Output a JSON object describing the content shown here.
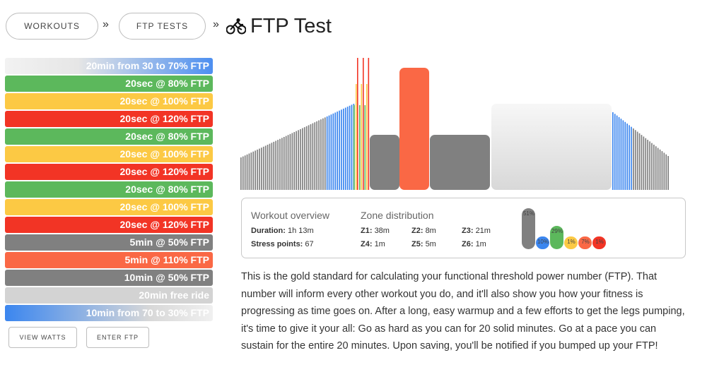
{
  "breadcrumb": {
    "workouts_label": "WORKOUTS",
    "ftp_tests_label": "FTP TESTS",
    "separator": "»",
    "title": "FTP Test",
    "title_icon": "cyclist-icon"
  },
  "segments": [
    {
      "label": "20min from 30 to 70% FTP",
      "color": "#4d8ff0"
    },
    {
      "label": "20sec @ 80% FTP",
      "color": "#5cb85c"
    },
    {
      "label": "20sec @ 100% FTP",
      "color": "#fcc944"
    },
    {
      "label": "20sec @ 120% FTP",
      "color": "#f23425"
    },
    {
      "label": "20sec @ 80% FTP",
      "color": "#5cb85c"
    },
    {
      "label": "20sec @ 100% FTP",
      "color": "#fcc944"
    },
    {
      "label": "20sec @ 120% FTP",
      "color": "#f23425"
    },
    {
      "label": "20sec @ 80% FTP",
      "color": "#5cb85c"
    },
    {
      "label": "20sec @ 100% FTP",
      "color": "#fcc944"
    },
    {
      "label": "20sec @ 120% FTP",
      "color": "#f23425"
    },
    {
      "label": "5min @ 50% FTP",
      "color": "#808080"
    },
    {
      "label": "5min @ 110% FTP",
      "color": "#fa6845"
    },
    {
      "label": "10min @ 50% FTP",
      "color": "#808080"
    },
    {
      "label": "20min free ride",
      "color": "#d3d3d3"
    },
    {
      "label": "10min from 70 to 30% FTP",
      "color": "#3b86ef"
    }
  ],
  "buttons": {
    "view_watts": "VIEW WATTS",
    "enter_ftp": "ENTER FTP"
  },
  "overview": {
    "heading": "Workout overview",
    "duration_label": "Duration:",
    "duration_value": "1h 13m",
    "stress_label": "Stress points:",
    "stress_value": "67"
  },
  "zones": {
    "heading": "Zone distribution",
    "items": [
      {
        "label": "Z1:",
        "value": "38m"
      },
      {
        "label": "Z2:",
        "value": "8m"
      },
      {
        "label": "Z3:",
        "value": "21m"
      },
      {
        "label": "Z4:",
        "value": "1m"
      },
      {
        "label": "Z5:",
        "value": "5m"
      },
      {
        "label": "Z6:",
        "value": "1m"
      }
    ]
  },
  "zone_chart": [
    {
      "percent": "51%",
      "value": 51,
      "color": "#808080"
    },
    {
      "percent": "10%",
      "value": 10,
      "color": "#3b86ef"
    },
    {
      "percent": "29%",
      "value": 29,
      "color": "#5cb85c"
    },
    {
      "percent": "1%",
      "value": 1,
      "color": "#fcc944"
    },
    {
      "percent": "7%",
      "value": 7,
      "color": "#fa6845"
    },
    {
      "percent": "1%",
      "value": 1,
      "color": "#f23425"
    }
  ],
  "description": "This is the gold standard for calculating your functional threshold power number (FTP). That number will inform every other workout you do, and it'll also show you how your fitness is progressing as time goes on. After a long, easy warmup and a few efforts to get the legs pumping, it's time to give it your all: Go as hard as you can for 20 solid minutes. Go at a pace you can sustain for the entire 20 minutes. Upon saving, you'll be notified if you bumped up your FTP!"
}
